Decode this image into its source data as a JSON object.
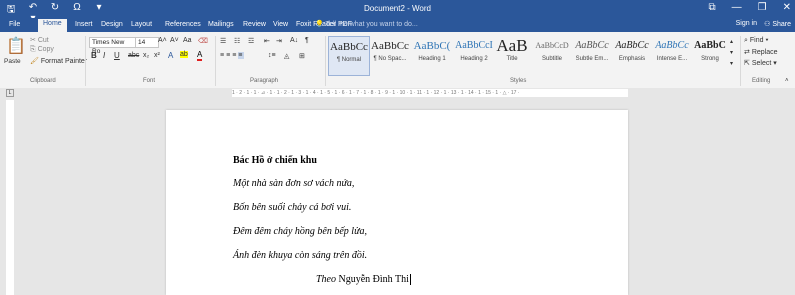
{
  "titlebar": {
    "title": "Document2 - Word",
    "save": "🖫",
    "undo": "↶ ▾",
    "redo": "↻",
    "omega": "Ω",
    "more": "▾",
    "ribbon_opts": "⧉",
    "min": "—",
    "restore": "❐",
    "close": "✕"
  },
  "tabs": [
    "File",
    "Home",
    "Insert",
    "Design",
    "Layout",
    "References",
    "Mailings",
    "Review",
    "View",
    "Foxit Reader PDF"
  ],
  "tellme": "Tell me what you want to do...",
  "signin": "Sign in",
  "share": "Share",
  "clipboard": {
    "paste": "Paste",
    "cut": "Cut",
    "copy": "Copy",
    "format_painter": "Format Painter",
    "label": "Clipboard"
  },
  "font": {
    "name": "Times New Ro",
    "size": "14",
    "grow": "A˄",
    "shrink": "A˅",
    "case": "Aa",
    "clear": "⌫",
    "bold": "B",
    "italic": "I",
    "underline": "U",
    "strike": "abc",
    "sub": "x₂",
    "sup": "x²",
    "effects": "A",
    "highlight": "ab",
    "color": "A",
    "label": "Font"
  },
  "paragraph": {
    "label": "Paragraph",
    "bullets": "☰",
    "numbering": "☷",
    "multilevel": "☲",
    "decrease_indent": "⇤",
    "increase_indent": "⇥",
    "sort": "A↓",
    "pilcrow": "¶"
  },
  "styles": {
    "label": "Styles",
    "items": [
      {
        "preview": "AaBbCc",
        "name": "¶ Normal"
      },
      {
        "preview": "AaBbCc",
        "name": "¶ No Spac..."
      },
      {
        "preview": "AaBbC(",
        "name": "Heading 1"
      },
      {
        "preview": "AaBbCcI",
        "name": "Heading 2"
      },
      {
        "preview": "AaB",
        "name": "Title"
      },
      {
        "preview": "AaBbCcD",
        "name": "Subtitle"
      },
      {
        "preview": "AaBbCc",
        "name": "Subtle Em..."
      },
      {
        "preview": "AaBbCc",
        "name": "Emphasis"
      },
      {
        "preview": "AaBbCc",
        "name": "Intense E..."
      },
      {
        "preview": "AaBbC",
        "name": "Strong"
      }
    ]
  },
  "editing": {
    "find": "Find",
    "replace": "Replace",
    "select": "Select",
    "label": "Editing"
  },
  "ruler": "1 · 2 · 1 · 1 · ⊿ · 1 · 1 · 2 · 1 · 3 · 1 · 4 · 1 · 5 · 1 · 6 · 1 · 7 · 1 · 8 · 1 · 9 · 1 · 10 · 1 · 11 · 1 · 12 · 1 · 13 · 1 · 14 · 1 · 15 · 1 · △ · 17 ·",
  "doc": {
    "title": "Bác Hồ ở chiến khu",
    "lines": [
      "Một nhà sàn đơn sơ vách nứa,",
      "Bốn bên suối chảy cá bơi vui.",
      "Đêm đêm cháy hồng bên bếp lửa,",
      "Ánh đèn khuya còn sáng trên đồi."
    ],
    "author_prefix": "Theo",
    "author": "Nguyễn Đình Thi"
  }
}
